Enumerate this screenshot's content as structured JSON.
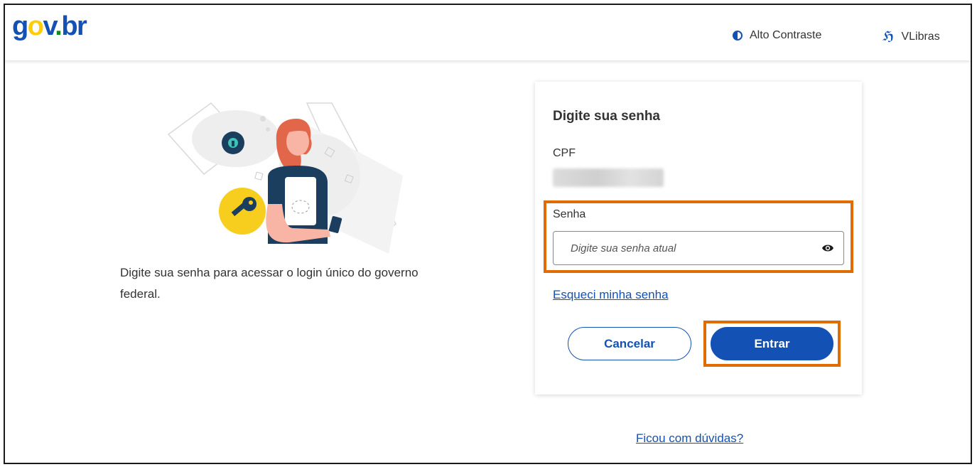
{
  "header": {
    "logo": {
      "g": "g",
      "o": "o",
      "v": "v",
      "dot": ".",
      "b": "b",
      "r": "r"
    },
    "contrast_label": "Alto Contraste",
    "vlibras_label": "VLibras"
  },
  "intro": {
    "text": "Digite sua senha para acessar o login único do governo federal."
  },
  "form": {
    "title": "Digite sua senha",
    "cpf_label": "CPF",
    "password_label": "Senha",
    "password_placeholder": "Digite sua senha atual",
    "forgot_link": "Esqueci minha senha",
    "cancel_button": "Cancelar",
    "enter_button": "Entrar"
  },
  "footer": {
    "help_link": "Ficou com dúvidas?"
  },
  "colors": {
    "primary": "#1351b4",
    "highlight": "#e06c00",
    "logo_yellow": "#ffcd07",
    "logo_green": "#168821"
  }
}
